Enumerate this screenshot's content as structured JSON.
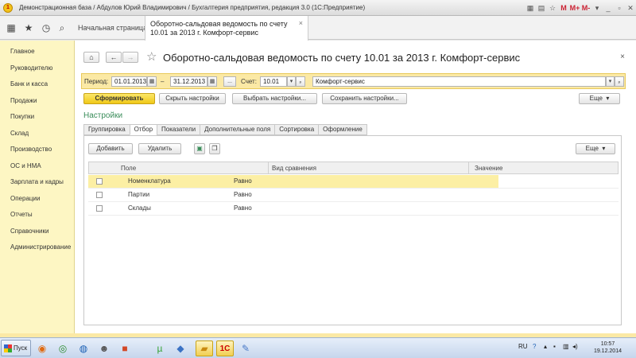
{
  "window": {
    "title": "Демонстрационная база / Абдулов Юрий Владимирович / Бухгалтерия предприятия, редакция 3.0  (1С:Предприятие)"
  },
  "tabs": {
    "home_label": "Начальная страница",
    "active_label": "Оборотно-сальдовая ведомость по счету 10.01 за 2013 г. Комфорт-сервис",
    "close_glyph": "×"
  },
  "sidebar": {
    "items": [
      {
        "label": "Главное"
      },
      {
        "label": "Руководителю"
      },
      {
        "label": "Банк и касса"
      },
      {
        "label": "Продажи"
      },
      {
        "label": "Покупки"
      },
      {
        "label": "Склад"
      },
      {
        "label": "Производство"
      },
      {
        "label": "ОС и НМА"
      },
      {
        "label": "Зарплата и кадры"
      },
      {
        "label": "Операции"
      },
      {
        "label": "Отчеты"
      },
      {
        "label": "Справочники"
      },
      {
        "label": "Администрирование"
      }
    ]
  },
  "header": {
    "title": "Оборотно-сальдовая ведомость по счету 10.01 за 2013 г. Комфорт-сервис",
    "back_glyph": "←",
    "forward_glyph": "→",
    "home_glyph": "⌂",
    "star_glyph": "☆",
    "close_glyph": "×"
  },
  "filters": {
    "period_label": "Период:",
    "date_from": "01.01.2013",
    "dash": "–",
    "date_to": "31.12.2013",
    "more_button": "...",
    "account_label": "Счет:",
    "account_value": "10.01",
    "org_value": "Комфорт-сервис"
  },
  "toolbar": {
    "generate_button": "Сформировать",
    "hide_settings_button": "Скрыть настройки",
    "choose_settings_button": "Выбрать настройки...",
    "save_settings_button": "Сохранить настройки...",
    "more_button": "Еще"
  },
  "settings": {
    "title": "Настройки",
    "tabs": [
      "Группировка",
      "Отбор",
      "Показатели",
      "Дополнительные поля",
      "Сортировка",
      "Оформление"
    ],
    "active_tab": "Отбор",
    "add_button": "Добавить",
    "delete_button": "Удалить",
    "more_button": "Еще",
    "columns": {
      "field": "Поле",
      "comparison": "Вид сравнения",
      "value": "Значение"
    },
    "rows": [
      {
        "field": "Номенклатура",
        "comparison": "Равно",
        "value": "",
        "selected": true
      },
      {
        "field": "Партии",
        "comparison": "Равно",
        "value": "",
        "selected": false
      },
      {
        "field": "Склады",
        "comparison": "Равно",
        "value": "",
        "selected": false
      }
    ]
  },
  "taskbar": {
    "start_label": "Пуск",
    "lang": "RU",
    "time": "10:57",
    "date": "19.12.2014"
  },
  "colors": {
    "accent_yellow": "#fbe9a5",
    "sidebar_bg": "#fdf6c3",
    "settings_green": "#3a8d5a"
  }
}
